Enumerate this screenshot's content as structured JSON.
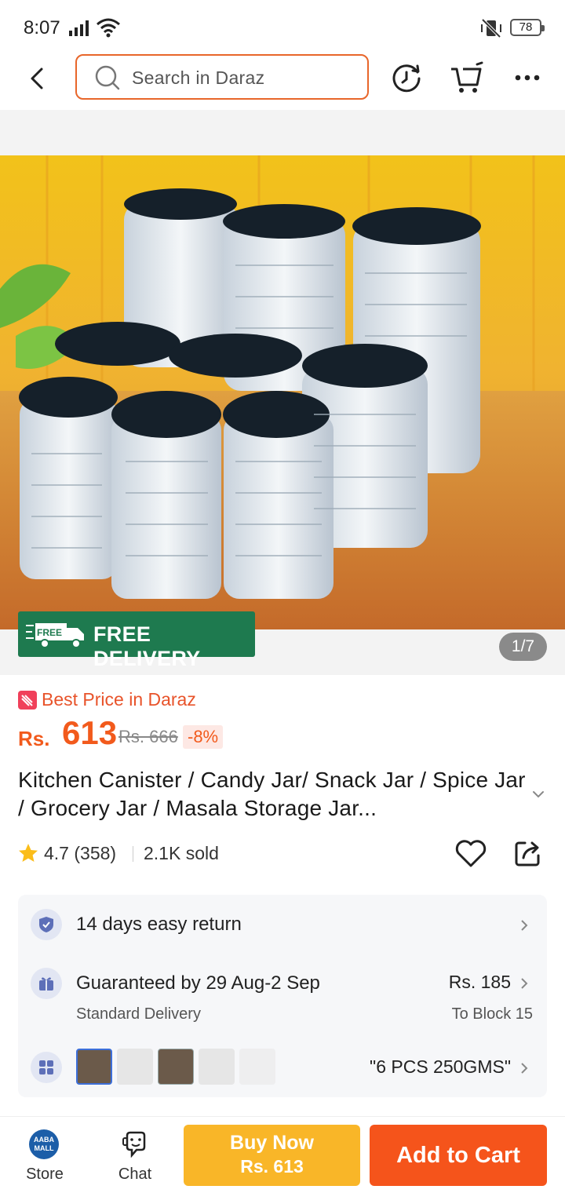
{
  "status_bar": {
    "time": "8:07",
    "battery": "78"
  },
  "search": {
    "placeholder": "Search in Daraz"
  },
  "product": {
    "image_counter": "1/7",
    "free_delivery_label": "FREE DELIVERY",
    "free_delivery_tag": "FREE",
    "best_price_label": "Best Price in Daraz",
    "currency": "Rs.",
    "price": "613",
    "original_price": "Rs. 666",
    "discount": "-8%",
    "title": "Kitchen Canister / Candy Jar/ Snack Jar / Spice Jar / Grocery Jar / Masala Storage Jar...",
    "rating": "4.7 (358)",
    "sold": "2.1K sold"
  },
  "info": {
    "return_label": "14 days easy return",
    "guarantee_label": "Guaranteed by 29 Aug-2 Sep",
    "delivery_type": "Standard Delivery",
    "delivery_fee": "Rs. 185",
    "destination": "To Block 15",
    "variant": "\"6 PCS 250GMS\""
  },
  "bottom": {
    "store_label": "Store",
    "store_logo": "AABA MALL",
    "chat_label": "Chat",
    "buy_now_label": "Buy Now",
    "buy_now_price": "Rs. 613",
    "add_to_cart_label": "Add to Cart"
  },
  "colors": {
    "accent": "#f5541b",
    "buy_now": "#f9b628",
    "free_delivery": "#1e7a4f",
    "search_border": "#e8662a"
  },
  "icons": [
    "back-icon",
    "search-icon",
    "history-icon",
    "cart-icon",
    "more-icon",
    "shield-check-icon",
    "gift-icon",
    "variant-grid-icon",
    "star-icon",
    "heart-icon",
    "share-icon",
    "chat-icon"
  ]
}
